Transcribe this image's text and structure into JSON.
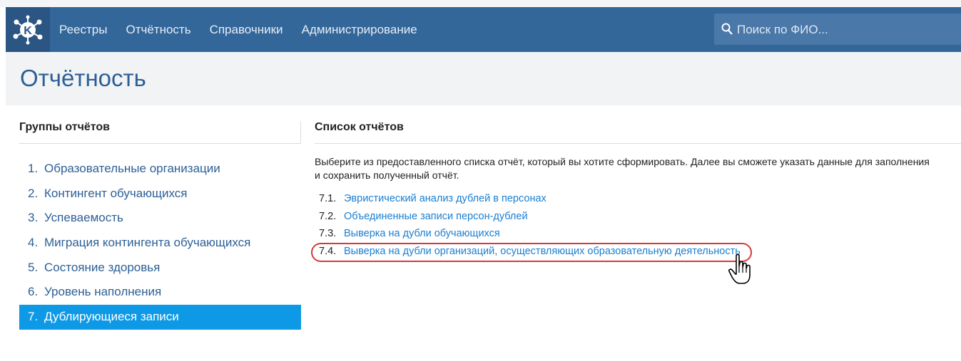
{
  "nav": {
    "items": [
      {
        "label": "Реестры",
        "active": false
      },
      {
        "label": "Отчётность",
        "active": true
      },
      {
        "label": "Справочники",
        "active": false
      },
      {
        "label": "Администрирование",
        "active": false
      }
    ]
  },
  "search": {
    "placeholder": "Поиск по ФИО..."
  },
  "page": {
    "title": "Отчётность"
  },
  "groups": {
    "heading": "Группы отчётов",
    "items": [
      {
        "num": "1.",
        "label": "Образовательные организации"
      },
      {
        "num": "2.",
        "label": "Контингент обучающихся"
      },
      {
        "num": "3.",
        "label": "Успеваемость"
      },
      {
        "num": "4.",
        "label": "Миграция контингента обучающихся"
      },
      {
        "num": "5.",
        "label": "Состояние здоровья"
      },
      {
        "num": "6.",
        "label": "Уровень наполнения"
      },
      {
        "num": "7.",
        "label": "Дублирующиеся записи"
      }
    ],
    "active_index": 6
  },
  "reports": {
    "heading": "Список отчётов",
    "description_line1": "Выберите из предоставленного списка отчёт, который вы хотите сформировать. Далее вы сможете указать данные для заполнения",
    "description_line2": "и сохранить полученный отчёт.",
    "items": [
      {
        "num": "7.1.",
        "label": "Эвристический анализ дублей в персонах"
      },
      {
        "num": "7.2.",
        "label": "Объединенные записи персон-дублей"
      },
      {
        "num": "7.3.",
        "label": "Выверка на дубли обучающихся"
      },
      {
        "num": "7.4.",
        "label": "Выверка на дубли организаций, осуществляющих образовательную деятельность"
      }
    ]
  },
  "icons": {
    "logo": "k-logo-icon",
    "search": "search-icon",
    "cursor": "hand-pointer-icon"
  },
  "colors": {
    "navbar": "#336699",
    "active_group": "#0d99e6",
    "link": "#1a7fd1",
    "highlight": "#d33a3a"
  }
}
